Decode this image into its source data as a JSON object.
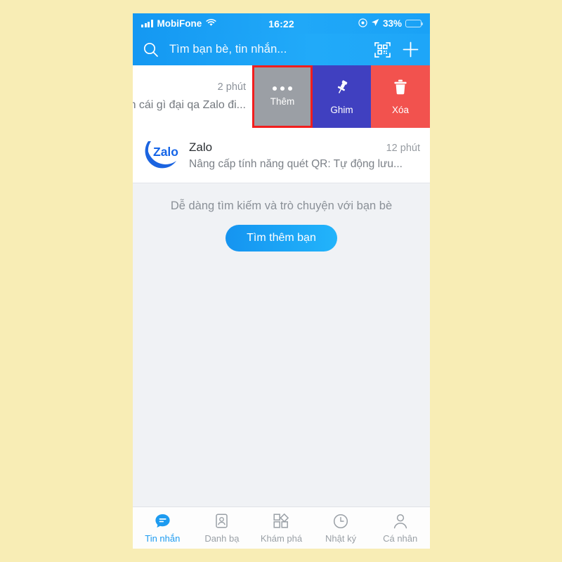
{
  "app": {
    "name": "Zalo",
    "background_color": "#f8edb5",
    "accent_color": "#1d9bf0",
    "header_color": "#1498f2"
  },
  "status_bar": {
    "carrier": "MobiFone",
    "signal_icon": "signal-bars-icon",
    "wifi_icon": "wifi-icon",
    "time": "16:22",
    "alarm_icon": "do-not-disturb-icon",
    "location_icon": "location-arrow-icon",
    "battery_percent": "33%",
    "battery_level": 33
  },
  "header": {
    "search_icon": "search-icon",
    "search_placeholder": "Tìm bạn bè, tin nhắn...",
    "qr_icon": "qr-scan-icon",
    "add_icon": "plus-icon"
  },
  "swipe_row": {
    "time": "2 phút",
    "snippet": "n cái gì đại qa Zalo đi...",
    "actions": [
      {
        "label": "Thêm",
        "icon": "more-dots-icon",
        "color": "#9b9fa5",
        "highlighted": true
      },
      {
        "label": "Ghim",
        "icon": "pin-icon",
        "color": "#4040c0",
        "highlighted": false
      },
      {
        "label": "Xóa",
        "icon": "trash-icon",
        "color": "#f2524e",
        "highlighted": false
      }
    ]
  },
  "conversations": [
    {
      "avatar": "zalo-logo-avatar",
      "name": "Zalo",
      "timestamp": "12 phút",
      "preview": "Nâng cấp tính năng quét QR: Tự động lưu..."
    }
  ],
  "promo": {
    "text": "Dễ dàng tìm kiếm và trò chuyện với bạn bè",
    "button_label": "Tìm thêm bạn"
  },
  "tabbar": {
    "items": [
      {
        "label": "Tin nhắn",
        "icon": "chat-bubble-icon",
        "active": true
      },
      {
        "label": "Danh bạ",
        "icon": "contact-card-icon",
        "active": false
      },
      {
        "label": "Khám phá",
        "icon": "discover-grid-icon",
        "active": false
      },
      {
        "label": "Nhật ký",
        "icon": "clock-icon",
        "active": false
      },
      {
        "label": "Cá nhân",
        "icon": "person-icon",
        "active": false
      }
    ]
  }
}
